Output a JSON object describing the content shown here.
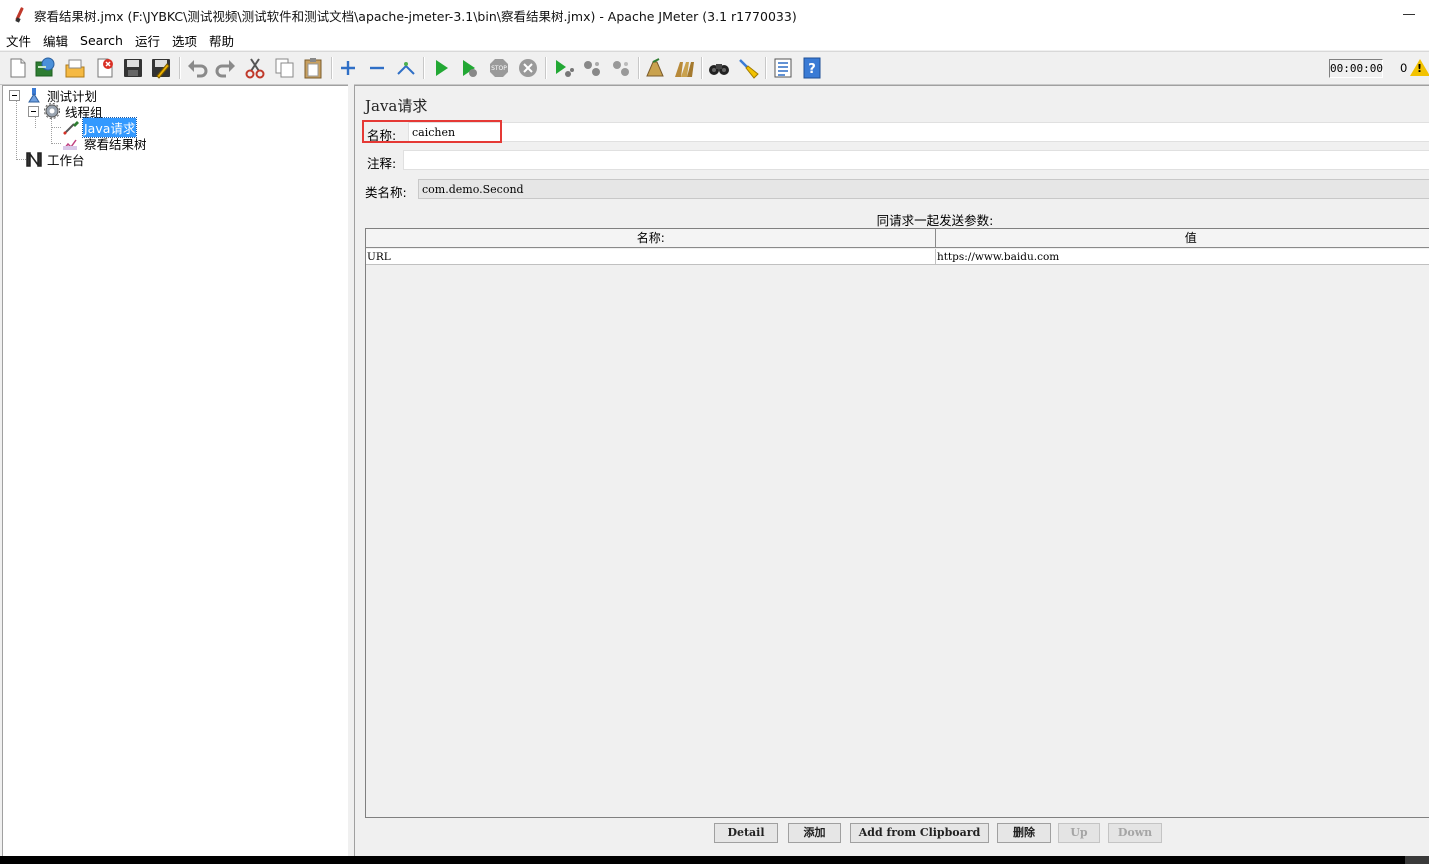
{
  "window": {
    "title": "察看结果树.jmx (F:\\JYBKC\\测试视频\\测试软件和测试文档\\apache-jmeter-3.1\\bin\\察看结果树.jmx) - Apache JMeter (3.1 r1770033)"
  },
  "menu": [
    "文件",
    "编辑",
    "Search",
    "运行",
    "选项",
    "帮助"
  ],
  "toolbar": {
    "timer": "00:00:00",
    "error_count": "0",
    "icons": [
      "new-icon",
      "templates-icon",
      "open-icon",
      "close-icon",
      "save-icon",
      "save-as-icon",
      "undo-icon",
      "redo-icon",
      "cut-icon",
      "copy-icon",
      "paste-icon",
      "expand-icon",
      "collapse-icon",
      "toggle-icon",
      "start-icon",
      "start-no-pause-icon",
      "stop-icon",
      "shutdown-icon",
      "remote-start-icon",
      "remote-stop-icon",
      "remote-shutdown-icon",
      "clear-icon",
      "clear-all-icon",
      "search-icon",
      "reset-search-icon",
      "function-helper-icon",
      "help-icon"
    ]
  },
  "tree": {
    "test_plan": "测试计划",
    "thread_group": "线程组",
    "java_request": "Java请求",
    "results_tree": "察看结果树",
    "workbench": "工作台"
  },
  "form": {
    "heading": "Java请求",
    "name_label": "名称:",
    "name_value": "caichen",
    "comment_label": "注释:",
    "comment_value": "",
    "classname_label": "类名称:",
    "classname_value": "com.demo.Second",
    "params_caption": "同请求一起发送参数:",
    "table": {
      "columns": [
        "名称:",
        "值"
      ],
      "rows": [
        {
          "name": "URL",
          "value": "https://www.baidu.com"
        }
      ]
    },
    "buttons": {
      "detail": "Detail",
      "add": "添加",
      "add_clipboard": "Add from Clipboard",
      "delete": "删除",
      "up": "Up",
      "down": "Down"
    }
  },
  "colors": {
    "selection": "#3399ff",
    "highlight_border": "#e53935",
    "panel_bg": "#f0f0f0"
  }
}
